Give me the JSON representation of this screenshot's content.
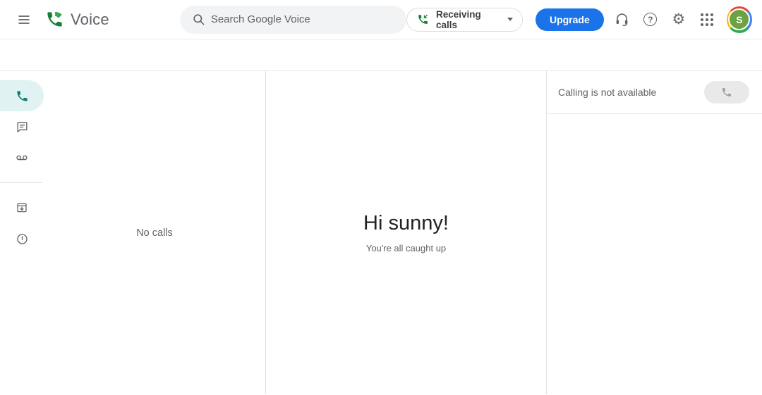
{
  "header": {
    "app_name": "Voice",
    "search": {
      "placeholder": "Search Google Voice"
    },
    "receiving_calls_label": "Receiving calls",
    "upgrade_label": "Upgrade",
    "help_glyph": "?",
    "gear_glyph": "⚙",
    "avatar_initial": "S"
  },
  "sidebar": {
    "items": [
      {
        "name": "calls",
        "icon": "phone-icon",
        "active": true
      },
      {
        "name": "messages",
        "icon": "chat-icon",
        "active": false
      },
      {
        "name": "voicemail",
        "icon": "voicemail-icon",
        "active": false
      },
      {
        "name": "archive",
        "icon": "archive-icon",
        "active": false
      },
      {
        "name": "spam",
        "icon": "spam-icon",
        "active": false
      }
    ]
  },
  "calls_panel": {
    "empty_text": "No calls"
  },
  "main": {
    "greeting": "Hi sunny!",
    "subtext": "You're all caught up"
  },
  "right_panel": {
    "status_text": "Calling is not available"
  },
  "icons": [
    "menu-icon",
    "voice-logo-icon",
    "search-icon",
    "receiving-call-icon",
    "dropdown-caret-icon",
    "headset-icon",
    "help-icon",
    "settings-gear-icon",
    "apps-grid-icon",
    "phone-icon",
    "chat-icon",
    "voicemail-icon",
    "archive-icon",
    "spam-icon",
    "disabled-call-icon"
  ],
  "colors": {
    "accent_blue": "#1a73e8",
    "brand_green_dark": "#188038",
    "brand_green_light": "#34a853",
    "active_teal": "#0b8073",
    "active_teal_bg": "#e0f2f1",
    "icon_gray": "#5f6368",
    "avatar_green": "#6da243",
    "border": "#e8eaed"
  }
}
